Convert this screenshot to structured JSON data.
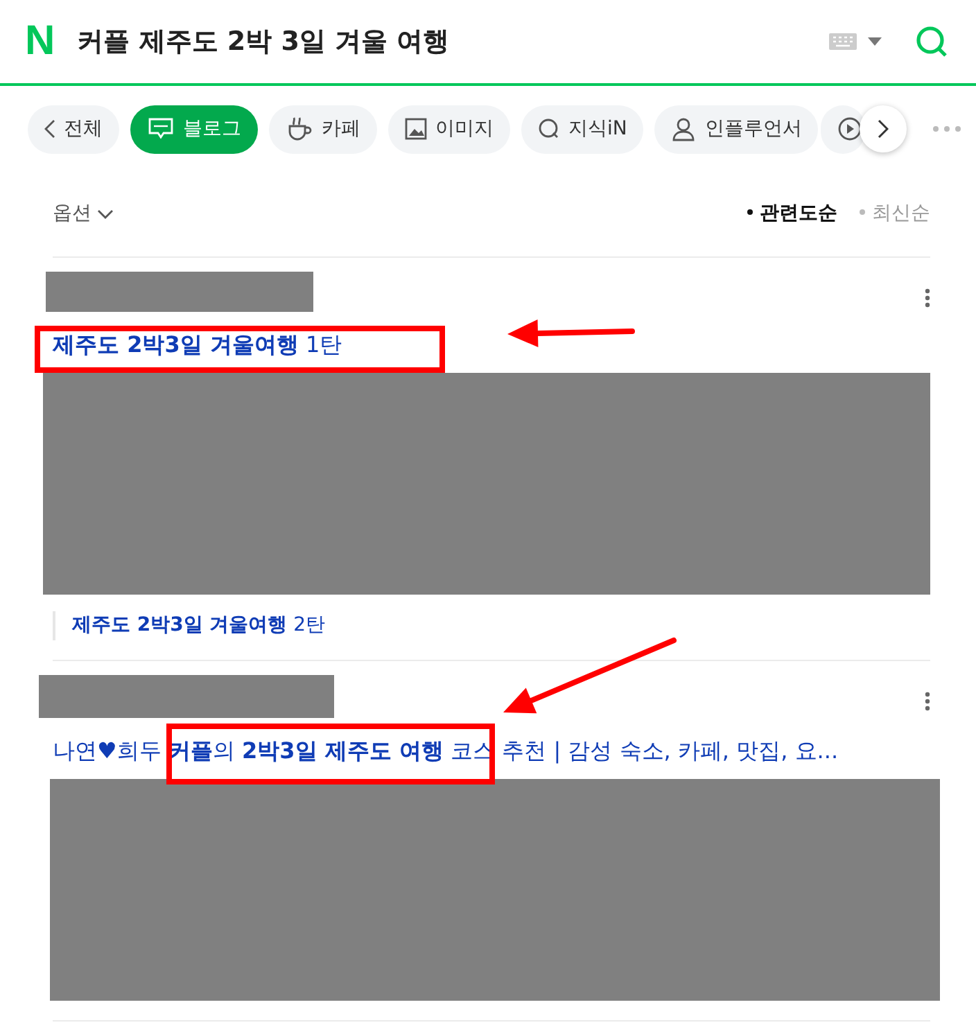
{
  "search": {
    "logo": "N",
    "query": "커플 제주도 2박 3일 겨울 여행"
  },
  "tabs": [
    {
      "label": "전체",
      "kind": "back",
      "selected": false
    },
    {
      "label": "블로그",
      "kind": "blog",
      "selected": true
    },
    {
      "label": "카페",
      "kind": "cafe",
      "selected": false
    },
    {
      "label": "이미지",
      "kind": "image",
      "selected": false
    },
    {
      "label": "지식iN",
      "kind": "kin",
      "selected": false
    },
    {
      "label": "인플루언서",
      "kind": "person",
      "selected": false
    },
    {
      "kind": "video",
      "selected": false
    }
  ],
  "options": {
    "label": "옵션"
  },
  "sort": [
    {
      "label": "관련도순",
      "selected": true
    },
    {
      "label": "최신순",
      "selected": false
    }
  ],
  "results": [
    {
      "title": "**제주도 2박3일 겨울여행** 1탄",
      "sub_links": [
        "**제주도 2박3일 겨울여행** 2탄"
      ]
    },
    {
      "title": "나연♥희두 **커플**의 **2박3일 제주도 여행** 코스 추천 | 감성 숙소, 카페, 맛집, 요..."
    }
  ]
}
